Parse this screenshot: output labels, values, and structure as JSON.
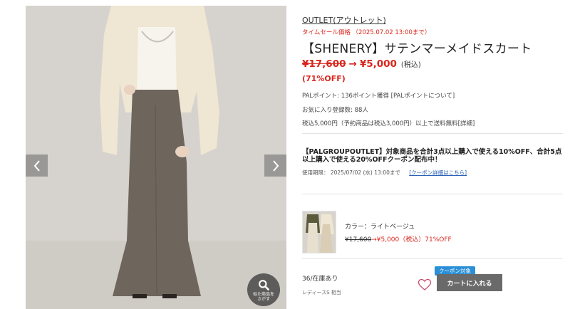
{
  "gallery": {
    "similar_button_label": "似た商品を\nさがす"
  },
  "product": {
    "outlet_link": "OUTLET(アウトレット)",
    "timesale_text": "タイムセール価格 （2025.07.02 13:00まで）",
    "title": "【SHENERY】サテンマーメイドスカート",
    "original_price": "¥17,600",
    "arrow": "→",
    "sale_price": "¥5,000",
    "tax_note": "(税込)",
    "discount": "(71%OFF)",
    "points": "PALポイント: 136ポイント獲得 [PALポイントについて]",
    "favorites": "お気に入り登録数: 88人",
    "shipping": "税込5,000円（予約商品は税込3,000円）以上で送料無料[詳細]"
  },
  "coupon": {
    "title": "【PALGROUPOUTLET】対象商品を合計3点以上購入で使える10%OFF、合計5点以上購入で使える20%OFFクーポン配布中！",
    "period": "使用期限： 2025/07/02 (水) 13:00まで",
    "details_link": "[クーポン詳細はこちら]"
  },
  "variant": {
    "color_label": "カラー：ライトベージュ",
    "old_price": "¥17,600",
    "new_price": "→¥5,000（税込）71%OFF"
  },
  "purchase": {
    "stock": "36/在庫あり",
    "size_note": "レディースS 相当",
    "coupon_badge": "クーポン対象",
    "add_to_cart": "カートに入れる"
  },
  "colors": {
    "sale_red": "#d9261c",
    "cart_button": "#6a6a6a",
    "coupon_badge": "#2a8fd6",
    "link_blue": "#2a62b8"
  },
  "icons": [
    "chevron-left-icon",
    "chevron-right-icon",
    "search-icon",
    "heart-icon"
  ]
}
